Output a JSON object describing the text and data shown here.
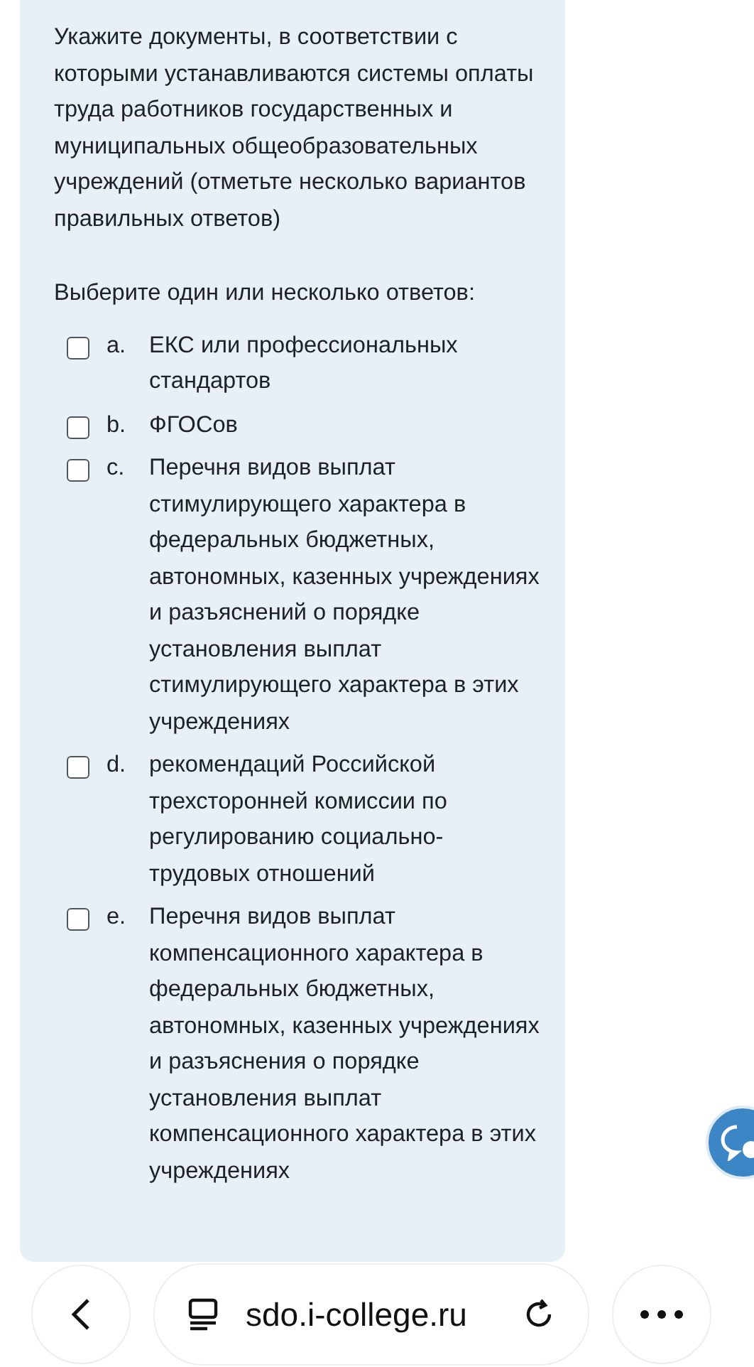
{
  "question": {
    "text": "Укажите документы, в соответствии с которыми устанавливаются системы оплаты труда работников государственных и муниципальных общеобразовательных учреждений (отметьте несколько вариантов правильных ответов)",
    "prompt": "Выберите один или несколько ответов:"
  },
  "options": [
    {
      "letter": "a.",
      "text": "ЕКС или профессиональных стандартов",
      "checked": false
    },
    {
      "letter": "b.",
      "text": "ФГОСов",
      "checked": false
    },
    {
      "letter": "c.",
      "text": "Перечня видов выплат стимулирующего характера в федеральных бюджетных, автономных, казенных учреждениях и разъяснений о порядке установления выплат стимулирующего характера в этих учреждениях",
      "checked": false
    },
    {
      "letter": "d.",
      "text": "рекомендаций Российской трехсторонней комиссии по регулированию социально-трудовых отношений",
      "checked": false
    },
    {
      "letter": "e.",
      "text": "Перечня видов выплат компенсационного характера в федеральных бюджетных, автономных, казенных учреждениях и разъяснения о порядке установления выплат компенсационного характера в этих учреждениях",
      "checked": false
    }
  ],
  "browser_bar": {
    "url": "sdo.i-college.ru"
  }
}
